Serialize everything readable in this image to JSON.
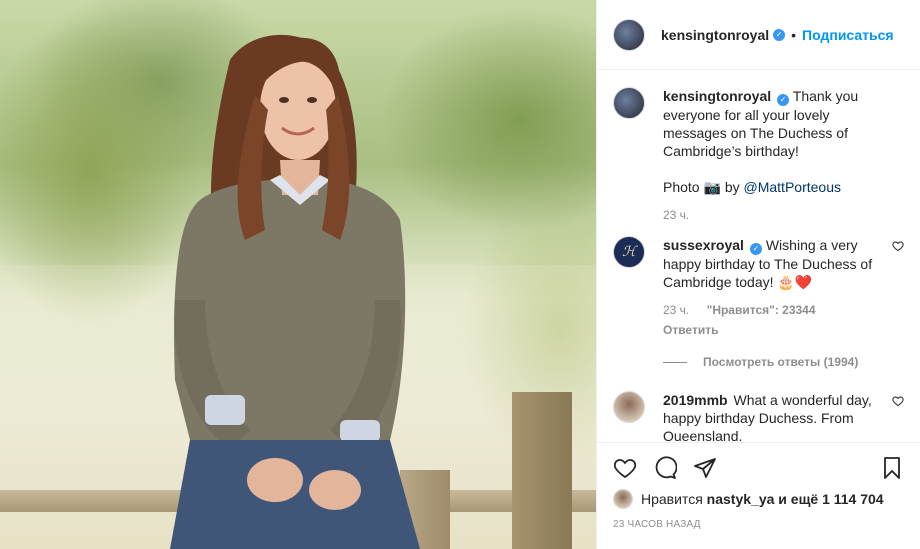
{
  "post": {
    "username": "kensingtonroyal",
    "follow_label": "Подписаться",
    "separator": "•",
    "caption": {
      "text": "Thank you everyone for all your lovely messages on The Duchess of Cambridge’s birthday!",
      "photo_prefix": "Photo",
      "camera_emoji": "📷",
      "by_label": "by",
      "credit": "@MattPorteous",
      "time": "23 ч."
    },
    "comments": [
      {
        "username": "sussexroyal",
        "text": "Wishing a very happy birthday to The Duchess of Cambridge today! 🎂❤️",
        "time": "23 ч.",
        "likes": "\"Нравится\": 23344",
        "reply_label": "Ответить",
        "view_replies": "Посмотреть ответы (1994)"
      },
      {
        "username": "2019mmb",
        "text": "What a wonderful day, happy birthday Duchess. From Queensland."
      }
    ],
    "likes": {
      "prefix": "Нравится",
      "user": "nastyk_ya",
      "middle": "и ещё",
      "count": "1 114 704"
    },
    "timestamp": "23 ЧАСОВ НАЗАД"
  },
  "icons": {
    "verified": "verified-badge-icon",
    "like": "heart-icon",
    "comment": "comment-icon",
    "share": "share-icon",
    "save": "bookmark-icon"
  },
  "colors": {
    "accent": "#0095f6",
    "verified": "#3897f0",
    "muted": "#8e8e8e",
    "heart_red": "#ed4956"
  }
}
